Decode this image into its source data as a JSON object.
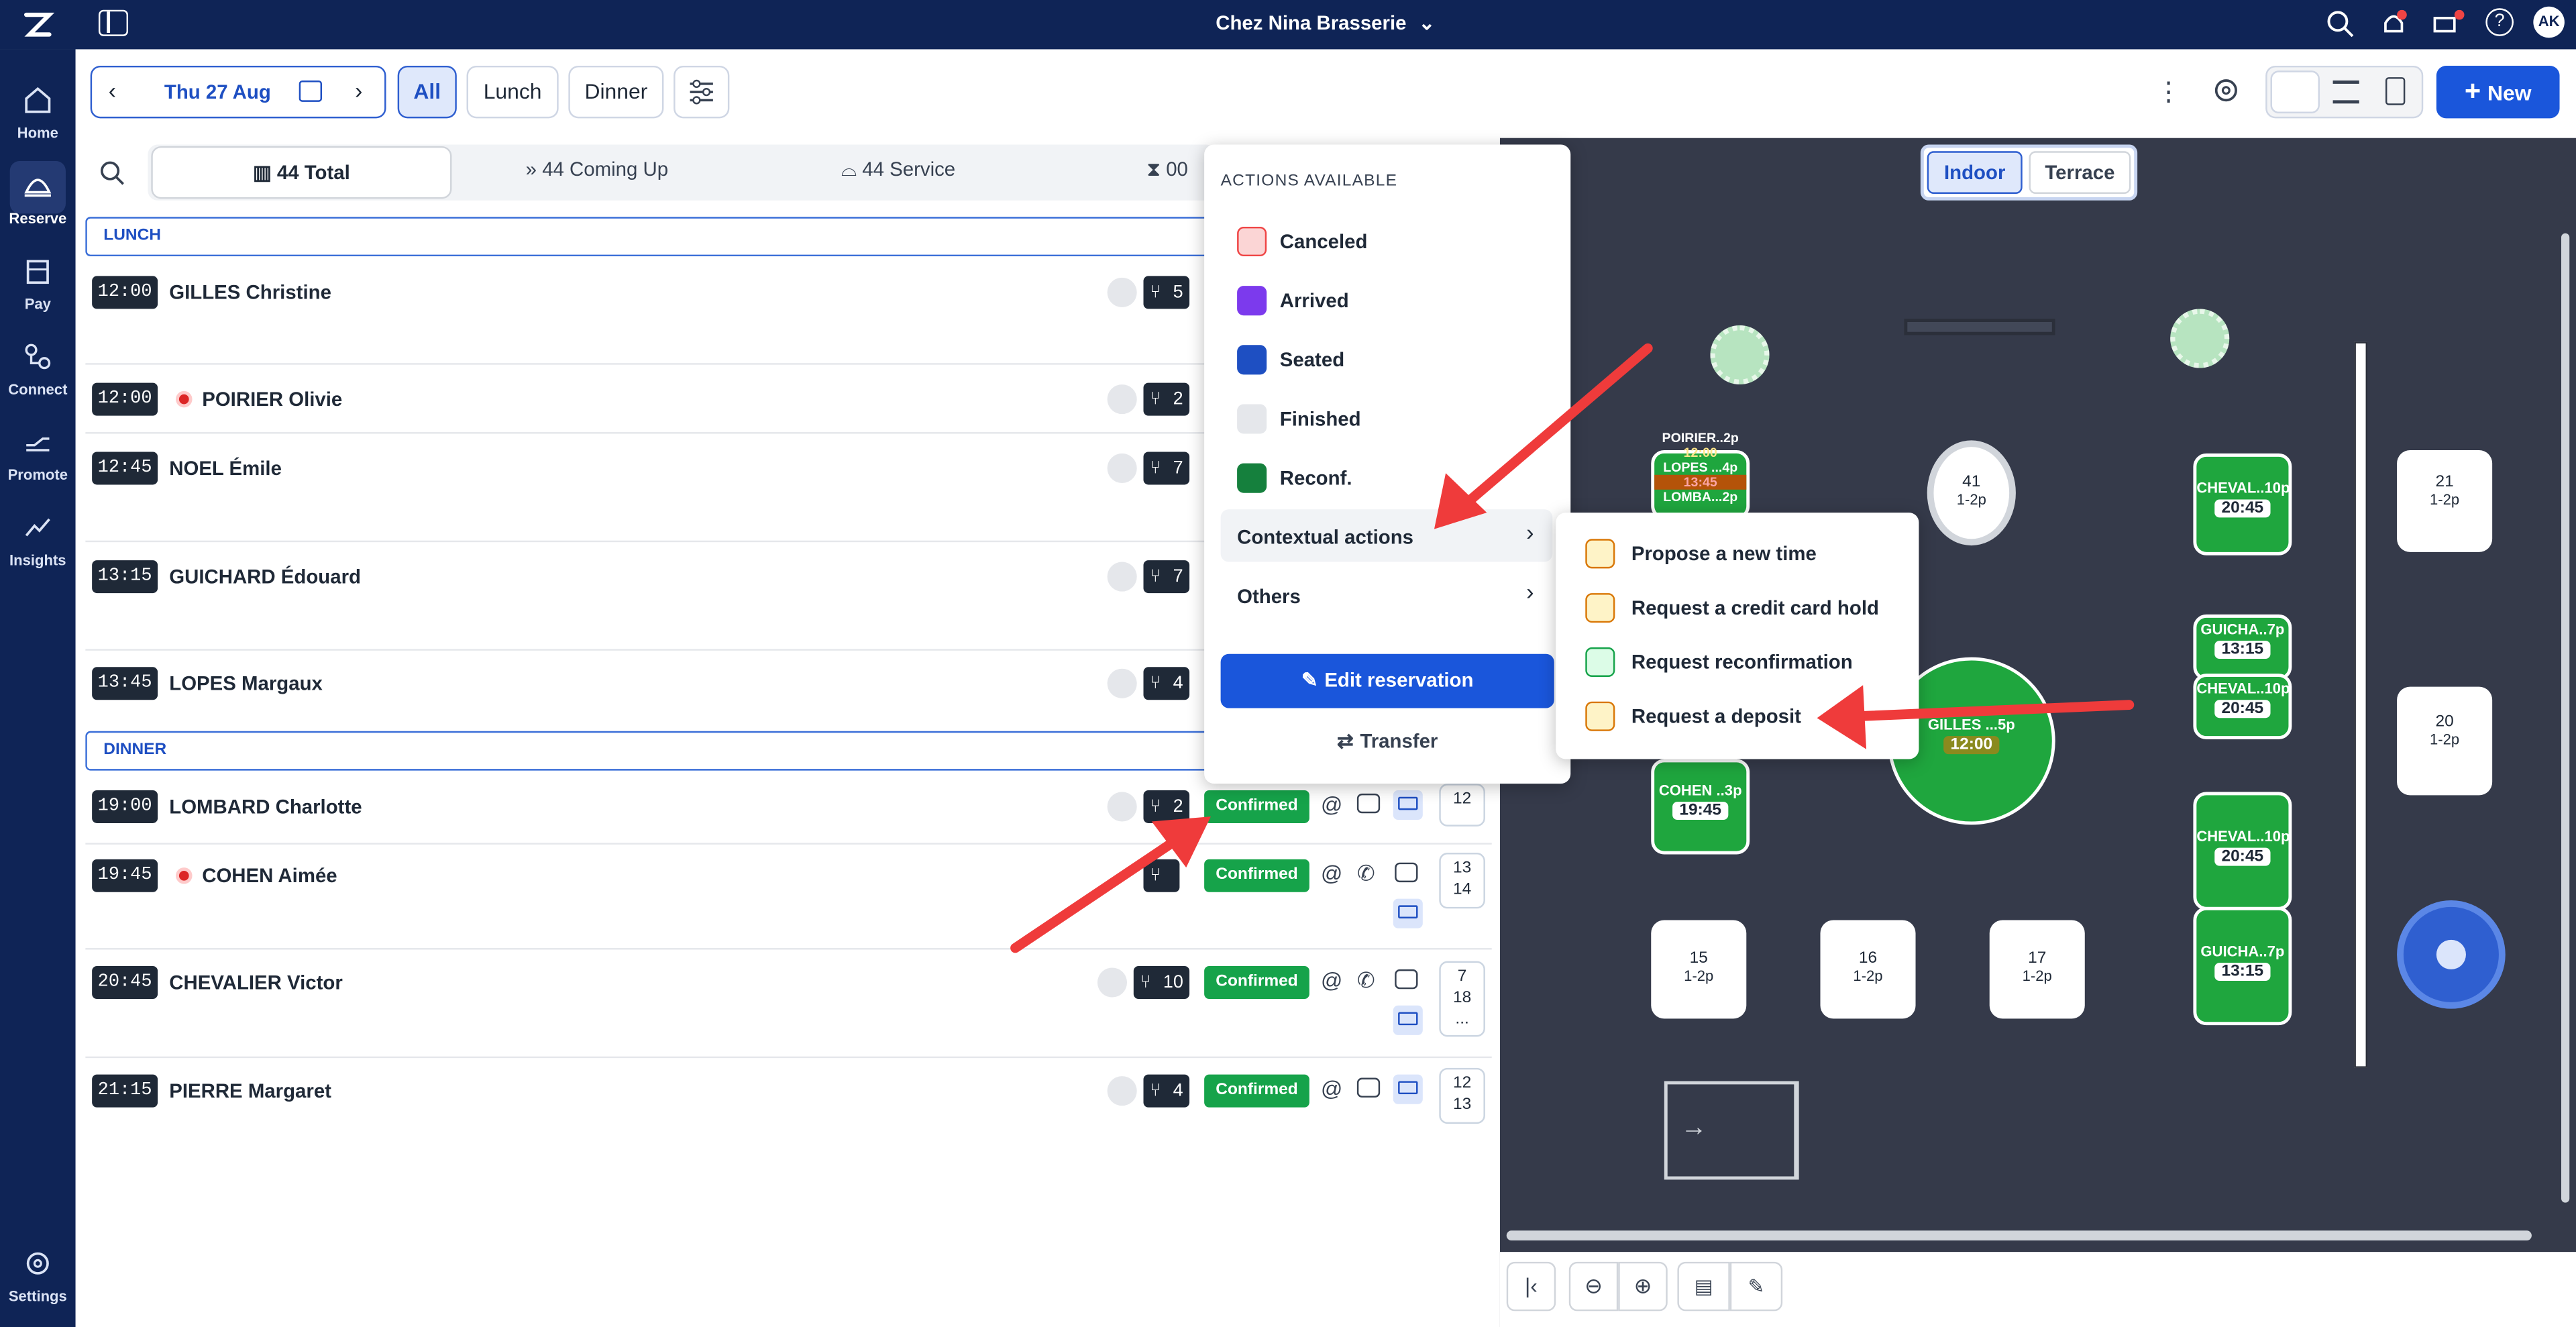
{
  "topbar": {
    "title": "Chez Nina Brasserie",
    "avatar": "AK"
  },
  "sidebar": {
    "items": [
      {
        "label": "Home",
        "icon": "home-icon"
      },
      {
        "label": "Reserve",
        "icon": "cloche-icon"
      },
      {
        "label": "Pay",
        "icon": "register-icon"
      },
      {
        "label": "Connect",
        "icon": "connect-icon"
      },
      {
        "label": "Promote",
        "icon": "promote-icon"
      },
      {
        "label": "Insights",
        "icon": "trend-icon"
      },
      {
        "label": "Settings",
        "icon": "gear-icon"
      }
    ]
  },
  "toolbar": {
    "date": "Thu 27 Aug",
    "filters": [
      "All",
      "Lunch",
      "Dinner"
    ],
    "new_label": "New"
  },
  "tabs": {
    "total": "44 Total",
    "coming": "44 Coming Up",
    "service": "44 Service",
    "waiting": "00"
  },
  "sections": {
    "lunch": "LUNCH",
    "dinner": "DINNER"
  },
  "reservations": [
    {
      "time": "12:00",
      "name": "GILLES Christine",
      "covers": "5",
      "alert": false
    },
    {
      "time": "12:00",
      "name": "POIRIER Olivie",
      "covers": "2",
      "alert": true
    },
    {
      "time": "12:45",
      "name": "NOEL Émile",
      "covers": "7",
      "alert": false
    },
    {
      "time": "13:15",
      "name": "GUICHARD Édouard",
      "covers": "7",
      "alert": false
    },
    {
      "time": "13:45",
      "name": "LOPES Margaux",
      "covers": "4",
      "alert": false
    },
    {
      "time": "19:00",
      "name": "LOMBARD Charlotte",
      "covers": "2",
      "alert": false,
      "status": "Confirmed",
      "tables": [
        "12"
      ]
    },
    {
      "time": "19:45",
      "name": "COHEN Aimée",
      "covers": "",
      "alert": true,
      "status": "Confirmed",
      "tables": [
        "13",
        "14"
      ]
    },
    {
      "time": "20:45",
      "name": "CHEVALIER Victor",
      "covers": "10",
      "alert": false,
      "status": "Confirmed",
      "tables": [
        "7",
        "18",
        "..."
      ]
    },
    {
      "time": "21:15",
      "name": "PIERRE Margaret",
      "covers": "4",
      "alert": false,
      "status": "Confirmed",
      "tables": [
        "12",
        "13"
      ]
    }
  ],
  "actions_menu": {
    "header": "ACTIONS AVAILABLE",
    "items": [
      "Canceled",
      "Arrived",
      "Seated",
      "Finished",
      "Reconf.",
      "Contextual actions",
      "Others"
    ],
    "edit": "Edit reservation",
    "transfer": "Transfer",
    "colors": {
      "canceled": "#fbd5d5",
      "arrived": "#7c3aed",
      "seated": "#1e4fc2",
      "finished": "#e5e7eb",
      "reconf": "#15803d"
    }
  },
  "contextual_menu": {
    "items": [
      "Propose a new time",
      "Request a credit card hold",
      "Request reconfirmation",
      "Request a deposit"
    ]
  },
  "map": {
    "tabs": [
      "Indoor",
      "Terrace"
    ],
    "tables": [
      {
        "label": "41",
        "cap": "1-2p"
      },
      {
        "label": "21",
        "cap": "1-2p"
      },
      {
        "label": "20",
        "cap": "1-2p"
      },
      {
        "label": "15",
        "cap": "1-2p"
      },
      {
        "label": "16",
        "cap": "1-2p"
      },
      {
        "label": "17",
        "cap": "1-2p"
      }
    ],
    "occupied": [
      {
        "label": "CHEVAL..10p",
        "time": "20:45"
      },
      {
        "label": "GUICHA..7p",
        "time": "13:15"
      },
      {
        "label": "CHEVAL..10p",
        "time": "20:45"
      },
      {
        "label": "GILLES ...5p",
        "time": "12:00"
      },
      {
        "label": "COHEN ..3p",
        "time": "19:45"
      },
      {
        "label": "CHEVAL..10p",
        "time": "20:45"
      },
      {
        "label": "GUICHA..7p",
        "time": "13:15"
      }
    ],
    "stack": {
      "l1": "POIRIER..2p",
      "t1": "12:00",
      "l2": "LOPES ...4p",
      "t2": "13:45",
      "l3": "LOMBA...2p"
    }
  }
}
